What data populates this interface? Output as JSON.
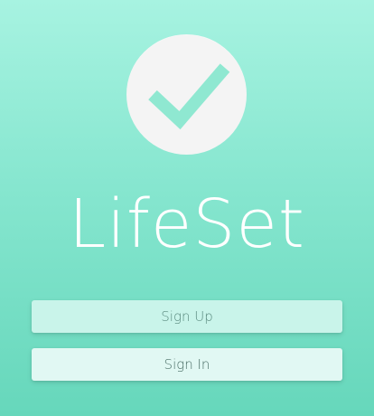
{
  "app": {
    "title": "LifeSet"
  },
  "logo": {
    "icon": "checkmark-icon",
    "circle_color": "#f4f4f4",
    "check_color": "#8fe8d1"
  },
  "actions": {
    "signup_label": "Sign Up",
    "signin_label": "Sign In"
  },
  "colors": {
    "gradient_top": "#a7f3e1",
    "gradient_bottom": "#66d7bb",
    "title_text": "#ffffff",
    "signup_bg": "#c9f4ea",
    "signin_bg": "#e1f8f3"
  }
}
